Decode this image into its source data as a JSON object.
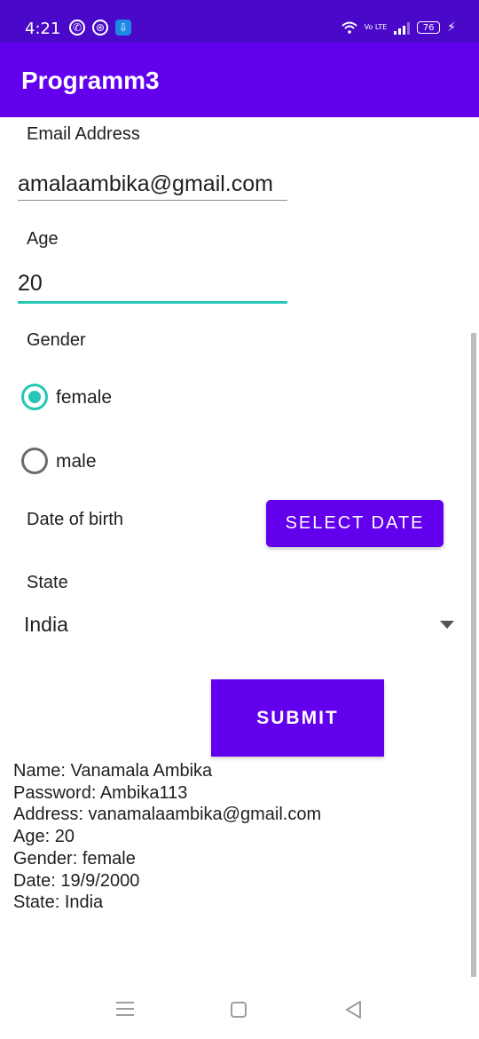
{
  "status_bar": {
    "time": "4:21",
    "battery": "76",
    "network_label": "Vo LTE"
  },
  "app_bar": {
    "title": "Programm3"
  },
  "form": {
    "email_label": "Email Address",
    "email_value": "amalaambika@gmail.com",
    "age_label": "Age",
    "age_value": "20",
    "gender_label": "Gender",
    "gender_options": [
      {
        "label": "female",
        "selected": true
      },
      {
        "label": "male",
        "selected": false
      }
    ],
    "dob_label": "Date of birth",
    "select_date_button": "SELECT DATE",
    "state_label": "State",
    "state_value": "India",
    "submit_button": "SUBMIT"
  },
  "result": {
    "lines": [
      "Name: Vanamala Ambika",
      "Password: Ambika113",
      "Address: vanamalaambika@gmail.com",
      "Age: 20",
      "Gender: female",
      "Date: 19/9/2000",
      "State: India"
    ]
  },
  "colors": {
    "status_bar": "#4a09c9",
    "primary": "#6200ee",
    "accent": "#26c6b4"
  }
}
